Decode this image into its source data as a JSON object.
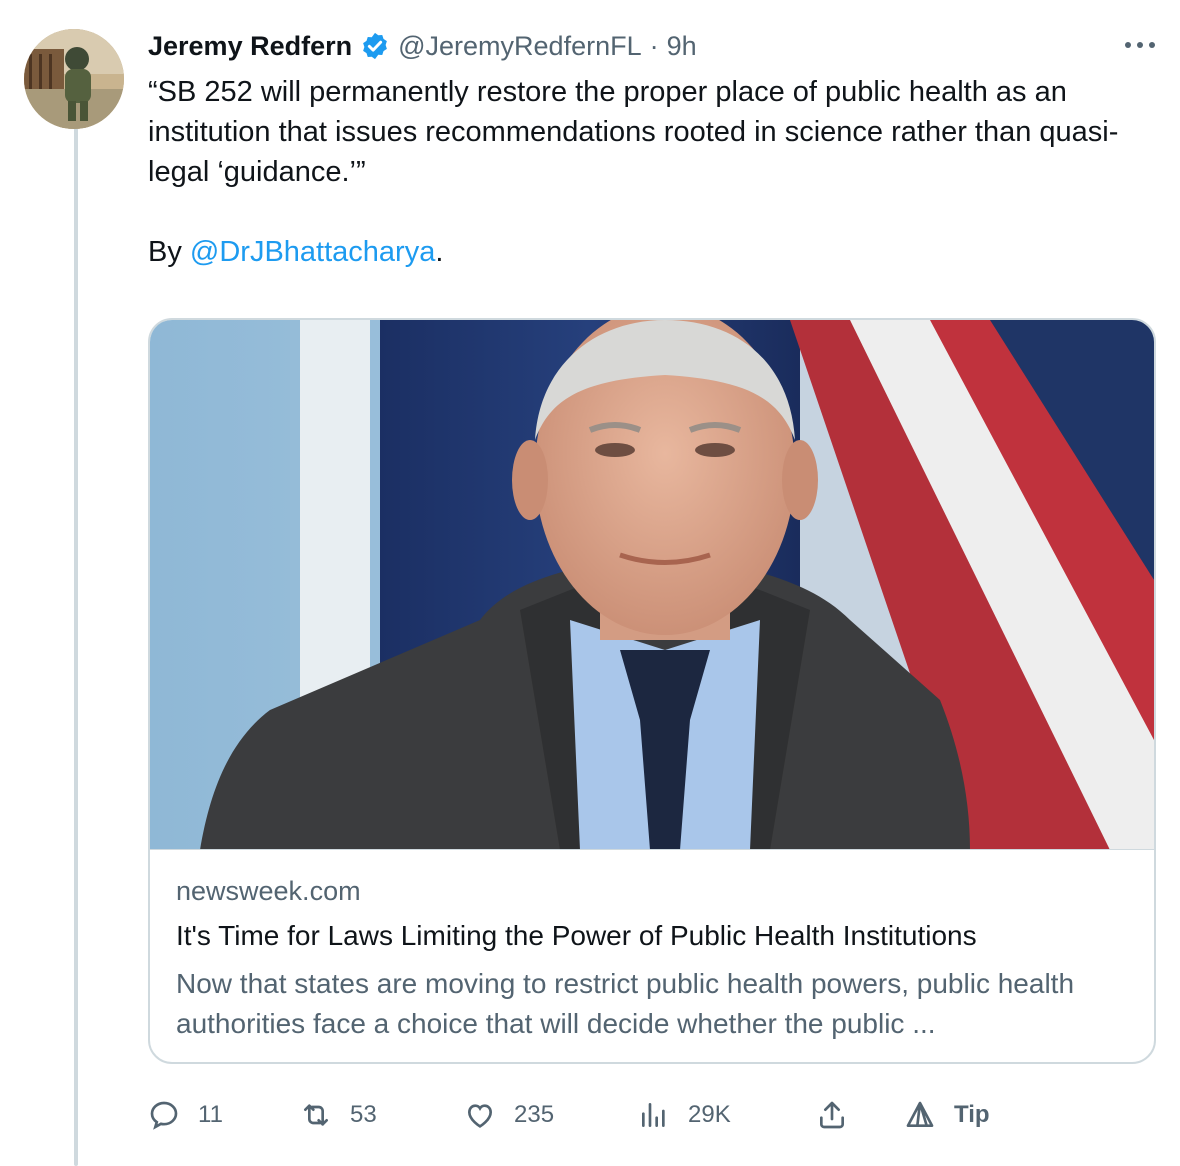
{
  "author": {
    "name": "Jeremy Redfern",
    "handle": "@JeremyRedfernFL",
    "separator": "·",
    "time": "9h"
  },
  "tweet": {
    "line1": "“SB 252 will permanently restore the proper place of public health as an institution that issues recommendations rooted in science rather than quasi-legal ‘guidance.’”",
    "by_prefix": "By ",
    "mention": "@DrJBhattacharya",
    "by_suffix": "."
  },
  "card": {
    "domain": "newsweek.com",
    "title": "It's Time for Laws Limiting the Power of Public Health Institutions",
    "description": "Now that states are moving to restrict public health powers, public health authorities face a choice that will decide whether the public ..."
  },
  "actions": {
    "replies": "11",
    "retweets": "53",
    "likes": "235",
    "views": "29K",
    "tip": "Tip"
  },
  "colors": {
    "link": "#1d9bf0",
    "muted": "#536471",
    "text": "#0f1419",
    "border": "#cfd9de"
  },
  "icons": [
    "verified-badge-icon",
    "more-icon",
    "reply-icon",
    "retweet-icon",
    "like-icon",
    "views-icon",
    "share-icon",
    "tip-icon"
  ]
}
